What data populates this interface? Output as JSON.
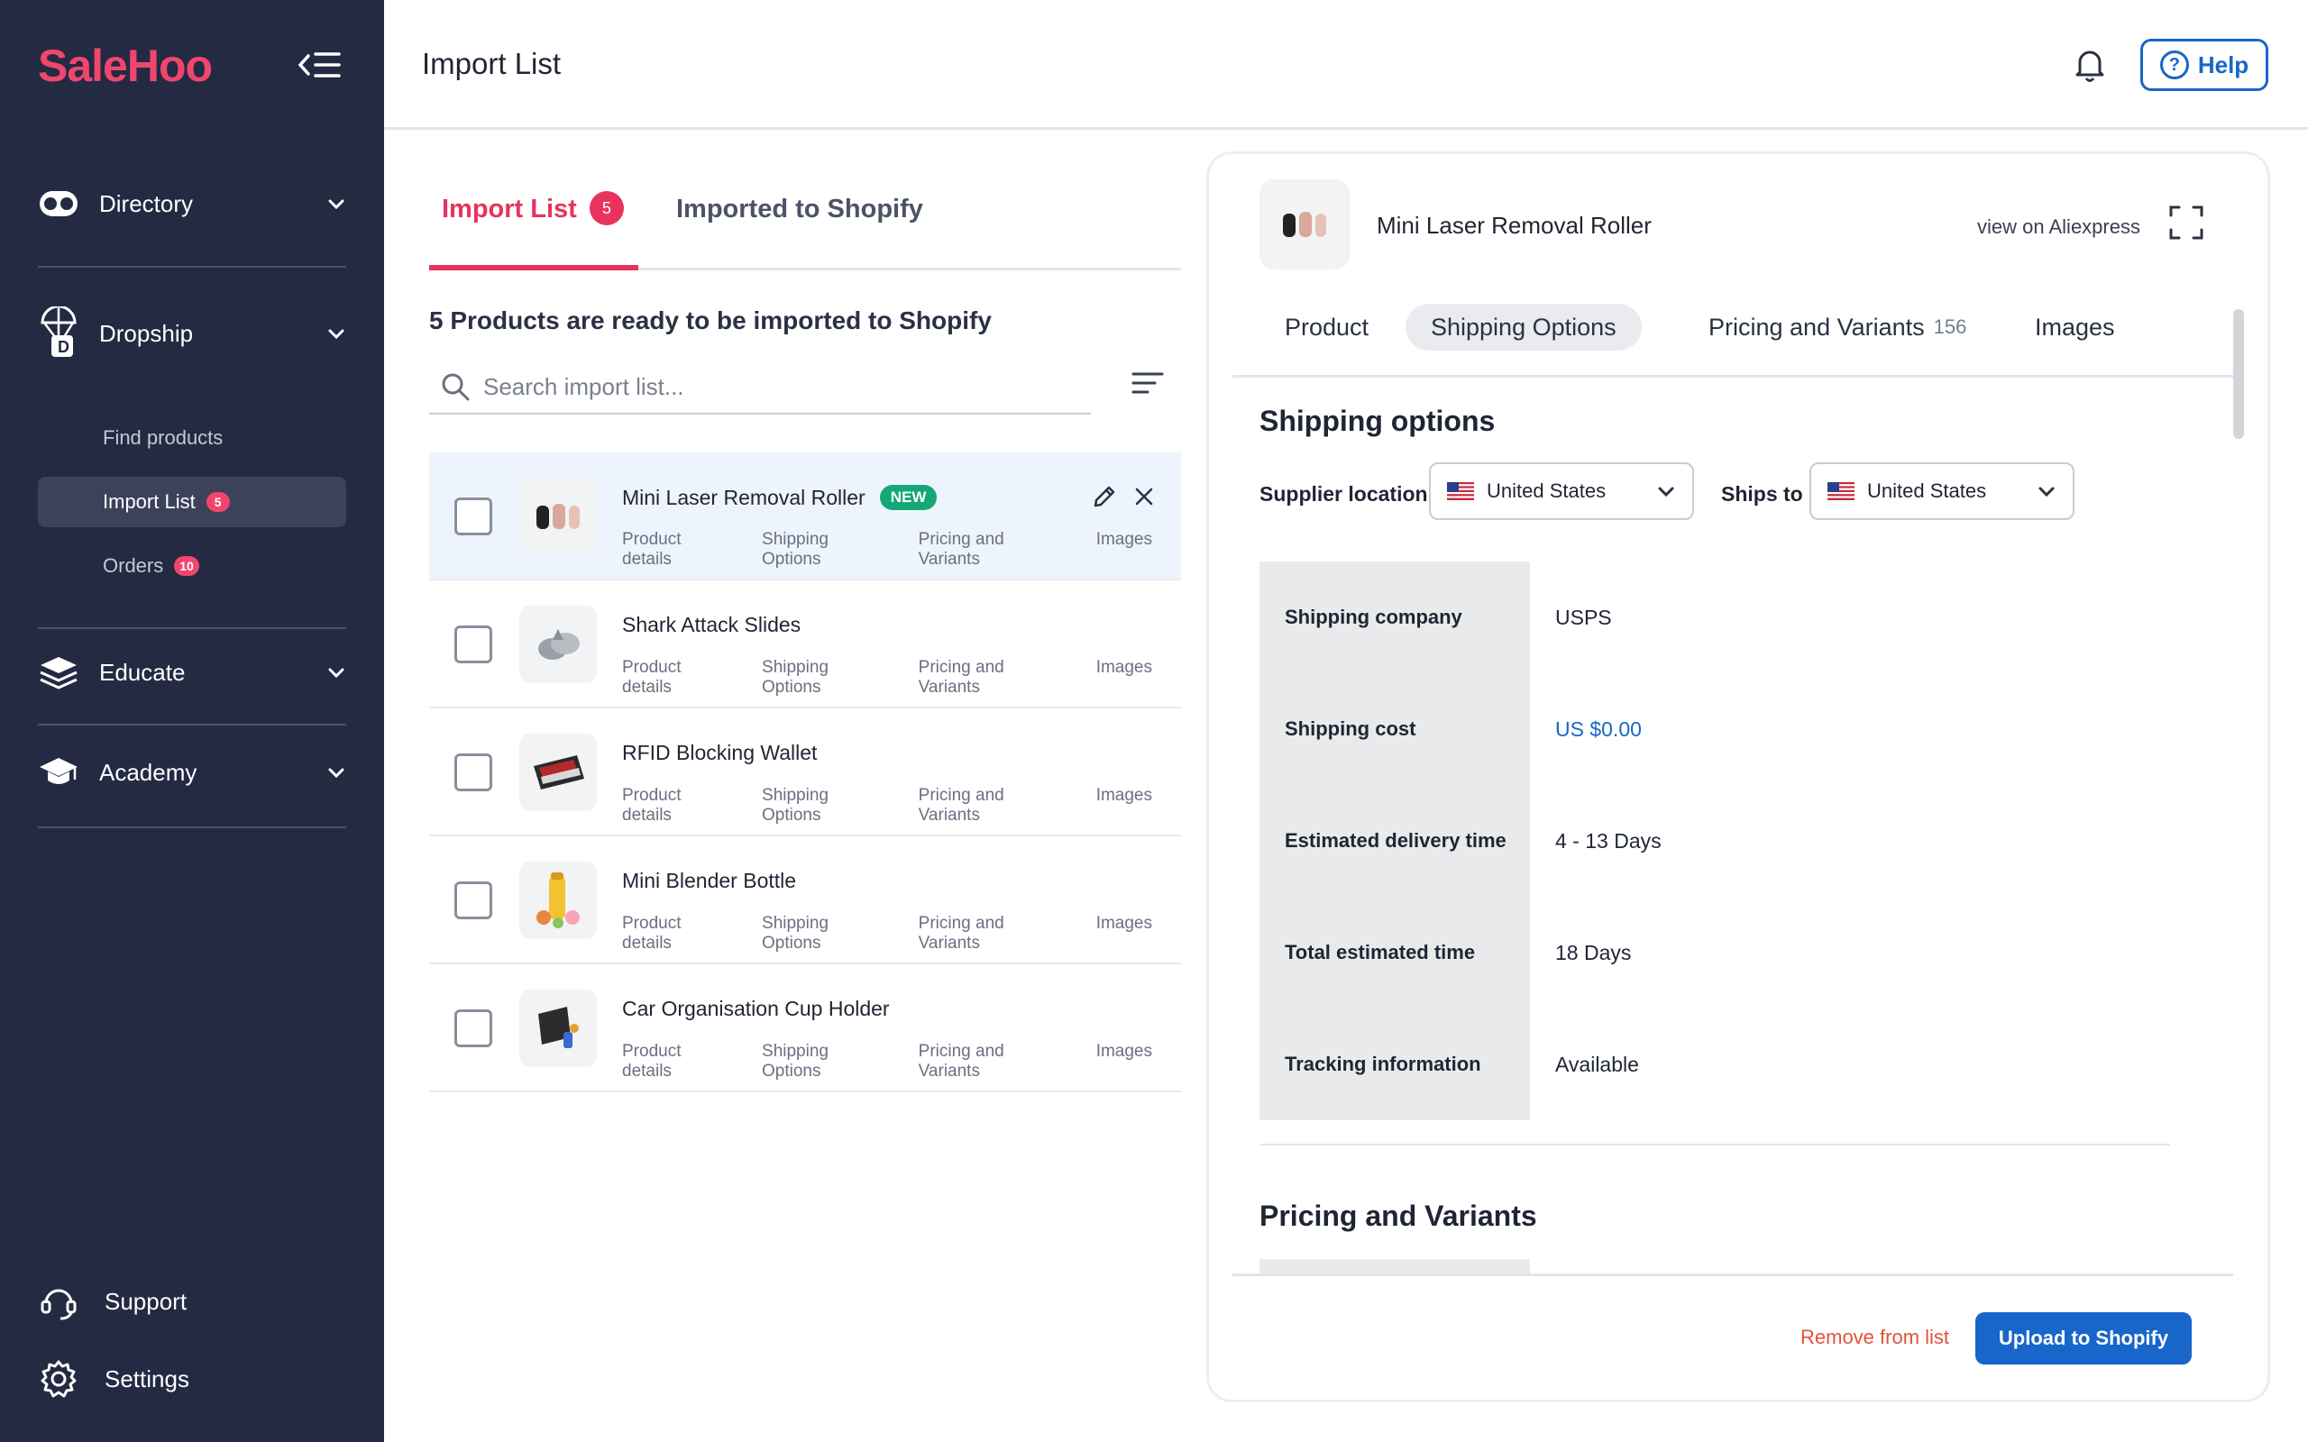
{
  "app": {
    "brand": "SaleHoo"
  },
  "header": {
    "title": "Import List",
    "help_label": "Help"
  },
  "sidebar": {
    "sections": [
      {
        "label": "Directory"
      },
      {
        "label": "Dropship"
      },
      {
        "label": "Educate"
      },
      {
        "label": "Academy"
      }
    ],
    "dropship_items": [
      {
        "label": "Find products"
      },
      {
        "label": "Import List",
        "badge": "5"
      },
      {
        "label": "Orders",
        "badge": "10"
      }
    ],
    "bottom": [
      {
        "label": "Support"
      },
      {
        "label": "Settings"
      }
    ]
  },
  "list": {
    "tabs": [
      {
        "label": "Import List",
        "badge": "5"
      },
      {
        "label": "Imported to Shopify"
      }
    ],
    "ready_text": "5 Products are ready to be imported to Shopify",
    "search_placeholder": "Search import list...",
    "link_labels": [
      "Product details",
      "Shipping Options",
      "Pricing and Variants",
      "Images"
    ],
    "new_badge": "NEW",
    "products": [
      {
        "name": "Mini Laser Removal Roller"
      },
      {
        "name": "Shark Attack Slides"
      },
      {
        "name": "RFID Blocking Wallet"
      },
      {
        "name": "Mini Blender Bottle"
      },
      {
        "name": "Car Organisation Cup Holder"
      }
    ]
  },
  "detail": {
    "title": "Mini Laser Removal Roller",
    "aliexpress_label": "view on Aliexpress",
    "tabs": [
      {
        "label": "Product"
      },
      {
        "label": "Shipping Options"
      },
      {
        "label": "Pricing and Variants",
        "count": "156"
      },
      {
        "label": "Images"
      }
    ],
    "shipping_heading": "Shipping options",
    "supplier_location_label": "Supplier location",
    "supplier_location_value": "United States",
    "ships_to_label": "Ships to",
    "ships_to_value": "United States",
    "shipping_rows": [
      {
        "key": "Shipping company",
        "value": "USPS"
      },
      {
        "key": "Shipping cost",
        "value": "US $0.00"
      },
      {
        "key": "Estimated delivery time",
        "value": "4 - 13 Days"
      },
      {
        "key": "Total estimated time",
        "value": "18 Days"
      },
      {
        "key": "Tracking information",
        "value": "Available"
      }
    ],
    "pricing_heading": "Pricing and Variants",
    "remove_label": "Remove from list",
    "upload_label": "Upload to Shopify"
  },
  "colors": {
    "sidebar_bg": "#232a42",
    "brand": "#f0466d",
    "accent_blue": "#1866c9",
    "new_green": "#15a876",
    "remove_red": "#e2533a"
  },
  "icons": [
    "collapse-menu-icon",
    "directory-icon",
    "dropship-icon",
    "educate-icon",
    "academy-icon",
    "support-icon",
    "settings-icon",
    "bell-icon",
    "help-icon",
    "search-icon",
    "filter-icon",
    "edit-icon",
    "close-icon",
    "expand-icon",
    "chevron-down-icon",
    "us-flag-icon"
  ]
}
